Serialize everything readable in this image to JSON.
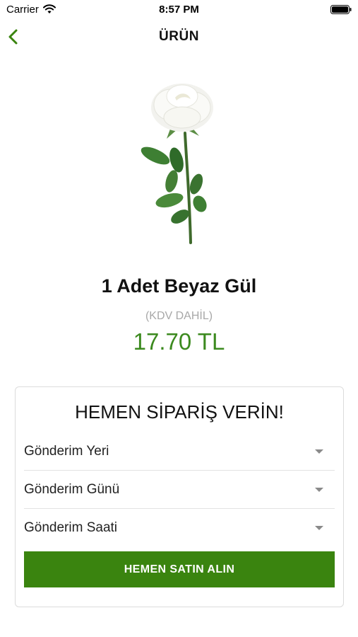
{
  "status_bar": {
    "carrier": "Carrier",
    "time": "8:57 PM"
  },
  "nav": {
    "title": "ÜRÜN"
  },
  "product": {
    "name": "1 Adet Beyaz Gül",
    "tax_note": "(KDV DAHİL)",
    "price": "17.70 TL"
  },
  "order": {
    "title": "HEMEN SİPARİŞ VERİN!",
    "selects": [
      {
        "label": "Gönderim Yeri"
      },
      {
        "label": "Gönderim Günü"
      },
      {
        "label": "Gönderim Saati"
      }
    ],
    "buy_label": "HEMEN SATIN ALIN"
  },
  "colors": {
    "accent_green": "#3a840f",
    "price_green": "#3c8a1f"
  }
}
